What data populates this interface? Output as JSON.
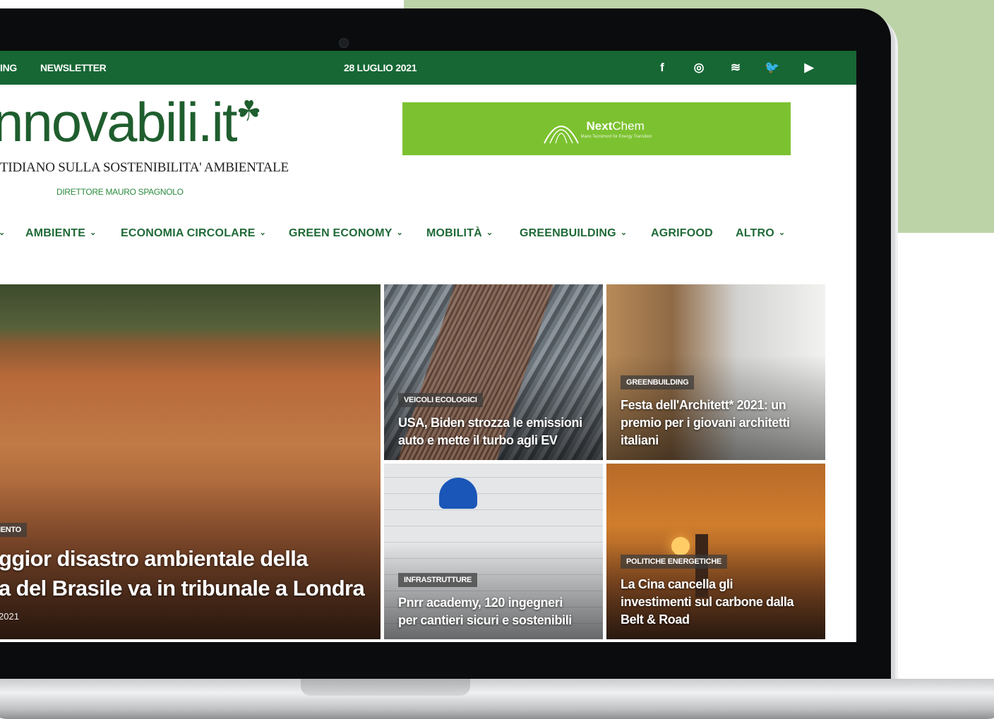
{
  "topbar": {
    "links": [
      "ING",
      "NEWSLETTER"
    ],
    "date": "28 LUGLIO 2021",
    "social_icons": [
      "facebook-icon",
      "instagram-icon",
      "rss-icon",
      "twitter-icon",
      "youtube-icon"
    ],
    "social_glyphs": [
      "f",
      "◎",
      "≋",
      "🐦",
      "▶"
    ]
  },
  "header": {
    "logo": "nnovabili.it",
    "tagline": "TIDIANO SULLA SOSTENIBILITA' AMBIENTALE",
    "director": "DIRETTORE MAURO SPAGNOLO",
    "banner": {
      "brand_bold": "Next",
      "brand_light": "Chem",
      "sub": "Maire Tecnimont for Energy Transition"
    }
  },
  "nav": {
    "items": [
      {
        "label": "AMBIENTE",
        "dropdown": true
      },
      {
        "label": "ECONOMIA CIRCOLARE",
        "dropdown": true
      },
      {
        "label": "GREEN ECONOMY",
        "dropdown": true
      },
      {
        "label": "MOBILITÀ",
        "dropdown": true
      },
      {
        "label": "GREENBUILDING",
        "dropdown": true
      },
      {
        "label": "AGRIFOOD",
        "dropdown": false
      },
      {
        "label": "ALTRO",
        "dropdown": true
      }
    ]
  },
  "articles": {
    "big": {
      "category": "IENTO",
      "title_line1": "ggior disastro ambientale della",
      "title_line2": "a del Brasile va in tribunale a Londra",
      "date": "2021"
    },
    "cars": {
      "category": "VEICOLI ECOLOGICI",
      "title_line1": "USA, Biden strozza le emissioni",
      "title_line2": "auto e mette il turbo agli EV"
    },
    "arch": {
      "category": "GREENBUILDING",
      "title_line1": "Festa dell'Architett* 2021: un",
      "title_line2": "premio per i giovani architetti",
      "title_line3": "italiani"
    },
    "plan": {
      "category": "INFRASTRUTTURE",
      "title_line1": "Pnrr academy, 120 ingegneri",
      "title_line2": "per cantieri sicuri e sostenibili"
    },
    "smoke": {
      "category": "POLITICHE ENERGETICHE",
      "title_line1": "La Cina cancella gli",
      "title_line2": "investimenti sul carbone dalla",
      "title_line3": "Belt & Road"
    }
  },
  "colors": {
    "brand_green": "#166734",
    "banner_green": "#7cc230",
    "nav_green": "#1f6a37"
  }
}
